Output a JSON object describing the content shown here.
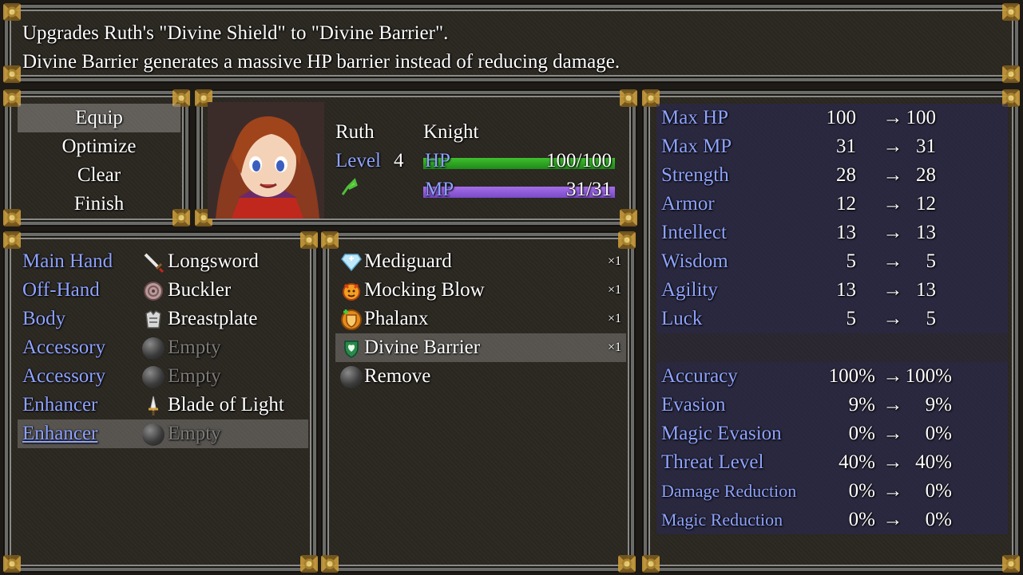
{
  "help": {
    "line1": "Upgrades Ruth's \"Divine Shield\" to \"Divine Barrier\".",
    "line2": "Divine Barrier generates a massive HP barrier instead of reducing damage."
  },
  "commands": [
    {
      "label": "Equip",
      "selected": true
    },
    {
      "label": "Optimize"
    },
    {
      "label": "Clear"
    },
    {
      "label": "Finish"
    }
  ],
  "actor": {
    "name": "Ruth",
    "class": "Knight",
    "level_label": "Level",
    "level": "4",
    "hp_label": "HP",
    "hp_text": "100/100",
    "hp_fraction": 1.0,
    "mp_label": "MP",
    "mp_text": "31/31",
    "mp_fraction": 1.0,
    "hp_color": "#3fbf2e",
    "mp_color": "#a56ee8"
  },
  "slots": [
    {
      "label": "Main Hand",
      "item": "Longsword",
      "icon": "sword-icon"
    },
    {
      "label": "Off-Hand",
      "item": "Buckler",
      "icon": "buckler-icon"
    },
    {
      "label": "Body",
      "item": "Breastplate",
      "icon": "breastplate-icon"
    },
    {
      "label": "Accessory",
      "item": "Empty",
      "icon": "empty-orb-icon",
      "empty": true
    },
    {
      "label": "Accessory",
      "item": "Empty",
      "icon": "empty-orb-icon",
      "empty": true
    },
    {
      "label": "Enhancer",
      "item": "Blade of Light",
      "icon": "blade-of-light-icon"
    },
    {
      "label": "Enhancer",
      "item": "Empty",
      "icon": "empty-orb-icon",
      "empty": true,
      "selected": true
    }
  ],
  "items": [
    {
      "name": "Mediguard",
      "count": "×1",
      "icon": "mediguard-icon"
    },
    {
      "name": "Mocking Blow",
      "count": "×1",
      "icon": "mocking-blow-icon"
    },
    {
      "name": "Phalanx",
      "count": "×1",
      "icon": "phalanx-icon"
    },
    {
      "name": "Divine Barrier",
      "count": "×1",
      "icon": "divine-barrier-icon",
      "selected": true
    },
    {
      "name": "Remove",
      "count": "",
      "icon": "remove-orb-icon"
    }
  ],
  "params": [
    {
      "name": "Max HP",
      "old": "100",
      "arrow": "→",
      "new": "100"
    },
    {
      "name": "Max MP",
      "old": "31",
      "arrow": "→",
      "new": "31"
    },
    {
      "name": "Strength",
      "old": "28",
      "arrow": "→",
      "new": "28"
    },
    {
      "name": "Armor",
      "old": "12",
      "arrow": "→",
      "new": "12"
    },
    {
      "name": "Intellect",
      "old": "13",
      "arrow": "→",
      "new": "13"
    },
    {
      "name": "Wisdom",
      "old": "5",
      "arrow": "→",
      "new": "5"
    },
    {
      "name": "Agility",
      "old": "13",
      "arrow": "→",
      "new": "13"
    },
    {
      "name": "Luck",
      "old": "5",
      "arrow": "→",
      "new": "5"
    }
  ],
  "params2": [
    {
      "name": "Accuracy",
      "old": "100%",
      "arrow": "→",
      "new": "100%"
    },
    {
      "name": "Evasion",
      "old": "9%",
      "arrow": "→",
      "new": "9%"
    },
    {
      "name": "Magic Evasion",
      "old": "0%",
      "arrow": "→",
      "new": "0%"
    },
    {
      "name": "Threat Level",
      "old": "40%",
      "arrow": "→",
      "new": "40%"
    },
    {
      "name": "Damage Reduction",
      "old": "0%",
      "arrow": "→",
      "new": "0%",
      "small": true
    },
    {
      "name": "Magic Reduction",
      "old": "0%",
      "arrow": "→",
      "new": "0%",
      "small": true
    }
  ]
}
